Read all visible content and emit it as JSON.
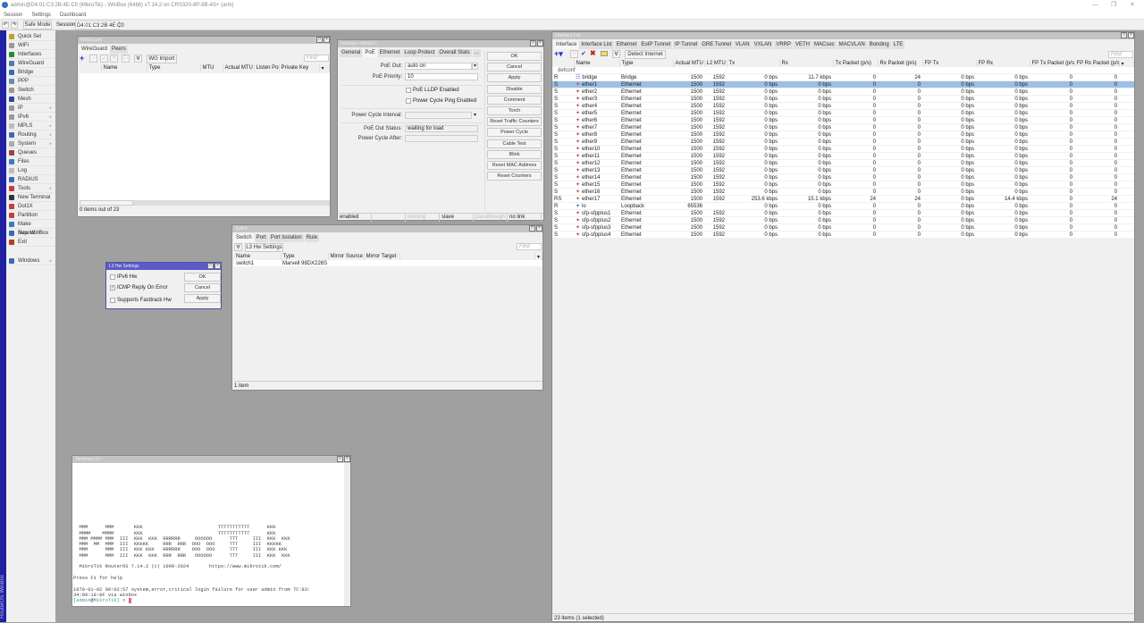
{
  "app": {
    "title": "admin@D4:01:C3:2B:4E:C0 (MikroTik) - WinBox (64bit) v7.14.2 on CRS320-8P-8B-4S+ (arm)",
    "menu": [
      "Session",
      "Settings",
      "Dashboard"
    ],
    "safe_mode": "Safe Mode",
    "session_label": "Session:",
    "session_value": "D4:01:C3:2B:4E:C0",
    "side_label": "RouterOS WinBox"
  },
  "sidebar": {
    "items": [
      {
        "label": "Quick Set",
        "color": "#c0a030"
      },
      {
        "label": "WiFi",
        "color": "#999"
      },
      {
        "label": "Interfaces",
        "color": "#2a8a2a"
      },
      {
        "label": "WireGuard",
        "color": "#4a7ab0"
      },
      {
        "label": "Bridge",
        "color": "#3a6ab0"
      },
      {
        "label": "PPP",
        "color": "#6a8ab0"
      },
      {
        "label": "Switch",
        "color": "#999"
      },
      {
        "label": "Mesh",
        "color": "#2a4a90"
      },
      {
        "label": "IP",
        "color": "#999",
        "sub": true
      },
      {
        "label": "IPv6",
        "color": "#999",
        "sub": true
      },
      {
        "label": "MPLS",
        "color": "#bbb",
        "sub": true
      },
      {
        "label": "Routing",
        "color": "#3a6ab0",
        "sub": true
      },
      {
        "label": "System",
        "color": "#aaa",
        "sub": true
      },
      {
        "label": "Queues",
        "color": "#a04040"
      },
      {
        "label": "Files",
        "color": "#3a7ac0"
      },
      {
        "label": "Log",
        "color": "#bbb"
      },
      {
        "label": "RADIUS",
        "color": "#3a6ab0"
      },
      {
        "label": "Tools",
        "color": "#c04040",
        "sub": true
      },
      {
        "label": "New Terminal",
        "color": "#333"
      },
      {
        "label": "Dot1X",
        "color": "#c04040"
      },
      {
        "label": "Partition",
        "color": "#c04040"
      },
      {
        "label": "Make Supout.rif",
        "color": "#3a7ac0"
      },
      {
        "label": "New WinBox",
        "color": "#3a6ab0"
      },
      {
        "label": "Exit",
        "color": "#b04020"
      },
      {
        "label": "Windows",
        "color": "#3a6ab0",
        "sub": true
      }
    ]
  },
  "wireguard": {
    "title": "WireGuard",
    "tabs": [
      "WireGuard",
      "Peers"
    ],
    "import": "WG Import",
    "find": "Find",
    "columns": [
      "Name",
      "Type",
      "MTU",
      "Actual MTU",
      "Listen Port",
      "Private Key"
    ],
    "status": "0 items out of 23"
  },
  "iface_win": {
    "title": "Interface <ether1>",
    "tabs": [
      "General",
      "PoE",
      "Ethernet",
      "Loop Protect",
      "Overall Stats",
      "..."
    ],
    "poe_out_label": "PoE Out:",
    "poe_out": "auto on",
    "poe_priority_label": "PoE Priority:",
    "poe_priority": "10",
    "lldp": "PoE LLDP Enabled",
    "ping": "Power Cycle Ping Enabled",
    "interval_label": "Power Cycle Interval:",
    "status_label": "PoE Out Status:",
    "status_value": "waiting for load",
    "after_label": "Power Cycle After:",
    "buttons": [
      "OK",
      "Cancel",
      "Apply",
      "Disable",
      "Comment",
      "Torch",
      "Reset Traffic Counters",
      "Power Cycle",
      "Cable Test",
      "Blink",
      "Reset MAC Address",
      "Reset Counters"
    ],
    "statusbar": [
      "enabled",
      "",
      "running",
      "slave",
      "passthrough",
      "no link"
    ]
  },
  "iface_list": {
    "title": "Interface List",
    "tabs": [
      "Interface",
      "Interface List",
      "Ethernet",
      "EoIP Tunnel",
      "IP Tunnel",
      "GRE Tunnel",
      "VLAN",
      "VXLAN",
      "VRRP",
      "VETH",
      "MACsec",
      "MACVLAN",
      "Bonding",
      "LTE"
    ],
    "detect": "Detect Internet",
    "find": "Find",
    "group": "defconf",
    "columns": [
      "",
      "Name",
      "Type",
      "Actual MTU",
      "L2 MTU",
      "Tx",
      "Rx",
      "Tx Packet (p/s)",
      "Rx Packet (p/s)",
      "FP Tx",
      "FP Rx",
      "FP Tx Packet (p/s)",
      "FP Rx Packet (p/s)"
    ],
    "rows": [
      [
        "R",
        "bridge",
        "Bridge",
        "1500",
        "1592",
        "0 bps",
        "11.7 kbps",
        "0",
        "24",
        "0 bps",
        "0 bps",
        "0",
        "0"
      ],
      [
        "S",
        "ether1",
        "Ethernet",
        "1500",
        "1592",
        "0 bps",
        "0 bps",
        "0",
        "0",
        "0 bps",
        "0 bps",
        "0",
        "0"
      ],
      [
        "S",
        "ether2",
        "Ethernet",
        "1500",
        "1592",
        "0 bps",
        "0 bps",
        "0",
        "0",
        "0 bps",
        "0 bps",
        "0",
        "0"
      ],
      [
        "S",
        "ether3",
        "Ethernet",
        "1500",
        "1592",
        "0 bps",
        "0 bps",
        "0",
        "0",
        "0 bps",
        "0 bps",
        "0",
        "0"
      ],
      [
        "S",
        "ether4",
        "Ethernet",
        "1500",
        "1592",
        "0 bps",
        "0 bps",
        "0",
        "0",
        "0 bps",
        "0 bps",
        "0",
        "0"
      ],
      [
        "S",
        "ether5",
        "Ethernet",
        "1500",
        "1592",
        "0 bps",
        "0 bps",
        "0",
        "0",
        "0 bps",
        "0 bps",
        "0",
        "0"
      ],
      [
        "S",
        "ether6",
        "Ethernet",
        "1500",
        "1592",
        "0 bps",
        "0 bps",
        "0",
        "0",
        "0 bps",
        "0 bps",
        "0",
        "0"
      ],
      [
        "S",
        "ether7",
        "Ethernet",
        "1500",
        "1592",
        "0 bps",
        "0 bps",
        "0",
        "0",
        "0 bps",
        "0 bps",
        "0",
        "0"
      ],
      [
        "S",
        "ether8",
        "Ethernet",
        "1500",
        "1592",
        "0 bps",
        "0 bps",
        "0",
        "0",
        "0 bps",
        "0 bps",
        "0",
        "0"
      ],
      [
        "S",
        "ether9",
        "Ethernet",
        "1500",
        "1592",
        "0 bps",
        "0 bps",
        "0",
        "0",
        "0 bps",
        "0 bps",
        "0",
        "0"
      ],
      [
        "S",
        "ether10",
        "Ethernet",
        "1500",
        "1592",
        "0 bps",
        "0 bps",
        "0",
        "0",
        "0 bps",
        "0 bps",
        "0",
        "0"
      ],
      [
        "S",
        "ether11",
        "Ethernet",
        "1500",
        "1592",
        "0 bps",
        "0 bps",
        "0",
        "0",
        "0 bps",
        "0 bps",
        "0",
        "0"
      ],
      [
        "S",
        "ether12",
        "Ethernet",
        "1500",
        "1592",
        "0 bps",
        "0 bps",
        "0",
        "0",
        "0 bps",
        "0 bps",
        "0",
        "0"
      ],
      [
        "S",
        "ether13",
        "Ethernet",
        "1500",
        "1592",
        "0 bps",
        "0 bps",
        "0",
        "0",
        "0 bps",
        "0 bps",
        "0",
        "0"
      ],
      [
        "S",
        "ether14",
        "Ethernet",
        "1500",
        "1592",
        "0 bps",
        "0 bps",
        "0",
        "0",
        "0 bps",
        "0 bps",
        "0",
        "0"
      ],
      [
        "S",
        "ether15",
        "Ethernet",
        "1500",
        "1592",
        "0 bps",
        "0 bps",
        "0",
        "0",
        "0 bps",
        "0 bps",
        "0",
        "0"
      ],
      [
        "S",
        "ether16",
        "Ethernet",
        "1500",
        "1592",
        "0 bps",
        "0 bps",
        "0",
        "0",
        "0 bps",
        "0 bps",
        "0",
        "0"
      ],
      [
        "RS",
        "ether17",
        "Ethernet",
        "1500",
        "1592",
        "253.6 kbps",
        "15.1 kbps",
        "24",
        "24",
        "0 bps",
        "14.4 kbps",
        "0",
        "24"
      ],
      [
        "R",
        "lo",
        "Loopback",
        "65536",
        "",
        "0 bps",
        "0 bps",
        "0",
        "0",
        "0 bps",
        "0 bps",
        "0",
        "0"
      ],
      [
        "S",
        "sfp-sfpplus1",
        "Ethernet",
        "1500",
        "1592",
        "0 bps",
        "0 bps",
        "0",
        "0",
        "0 bps",
        "0 bps",
        "0",
        "0"
      ],
      [
        "S",
        "sfp-sfpplus2",
        "Ethernet",
        "1500",
        "1592",
        "0 bps",
        "0 bps",
        "0",
        "0",
        "0 bps",
        "0 bps",
        "0",
        "0"
      ],
      [
        "S",
        "sfp-sfpplus3",
        "Ethernet",
        "1500",
        "1592",
        "0 bps",
        "0 bps",
        "0",
        "0",
        "0 bps",
        "0 bps",
        "0",
        "0"
      ],
      [
        "S",
        "sfp-sfpplus4",
        "Ethernet",
        "1500",
        "1592",
        "0 bps",
        "0 bps",
        "0",
        "0",
        "0 bps",
        "0 bps",
        "0",
        "0"
      ]
    ],
    "selected": "ether1",
    "status": "23 items (1 selected)"
  },
  "switch": {
    "title": "Switch",
    "tabs": [
      "Switch",
      "Port",
      "Port Isolation",
      "Rule"
    ],
    "l3": "L3 Hw Settings",
    "find": "Find",
    "columns": [
      "Name",
      "Type",
      "Mirror Source",
      "Mirror Target"
    ],
    "rows": [
      [
        "switch1",
        "Marvell 98DX226S",
        "",
        ""
      ]
    ],
    "status": "1 item"
  },
  "l3hw": {
    "title": "L3 Hw Settings",
    "ipv6": "IPv6 Hw",
    "icmp": "ICMP Reply On Error",
    "fasttrack": "Supports Fasttrack Hw",
    "ipv6_checked": false,
    "icmp_checked": true,
    "fasttrack_checked": false,
    "buttons": [
      "OK",
      "Cancel",
      "Apply"
    ]
  },
  "terminal": {
    "title": "Terminal <1>",
    "text": "\n\n\n\n\n\n\n\n\n\n\n  MMM      MMM       KKK                          TTTTTTTTTTT      KKK\n  MMMM    MMMM       KKK                          TTTTTTTTTTT      KKK\n  MMM MMMM MMM  III  KKK  KKK  RRRRRR     OOOOOO      TTT     III  KKK  KKK\n  MMM  MM  MMM  III  KKKKK     RRR  RRR  OOO  OOO     TTT     III  KKKKK\n  MMM      MMM  III  KKK KKK   RRRRRR    OOO  OOO     TTT     III  KKK KKK\n  MMM      MMM  III  KKK  KKK  RRR  RRR   OOOOOO      TTT     III  KKK  KKK\n\n  MikroTik RouterOS 7.14.2 (c) 1999-2024       https://www.mikrotik.com/\n\nPress F1 for help\n\n1970-01-02 00:02:57 system,error,critical login failure for user admin from 7C:83:\n34:89:18:8F via winbox",
    "prompt_user": "admin",
    "prompt_host": "MikroTik",
    "prompt_tail": " > "
  }
}
